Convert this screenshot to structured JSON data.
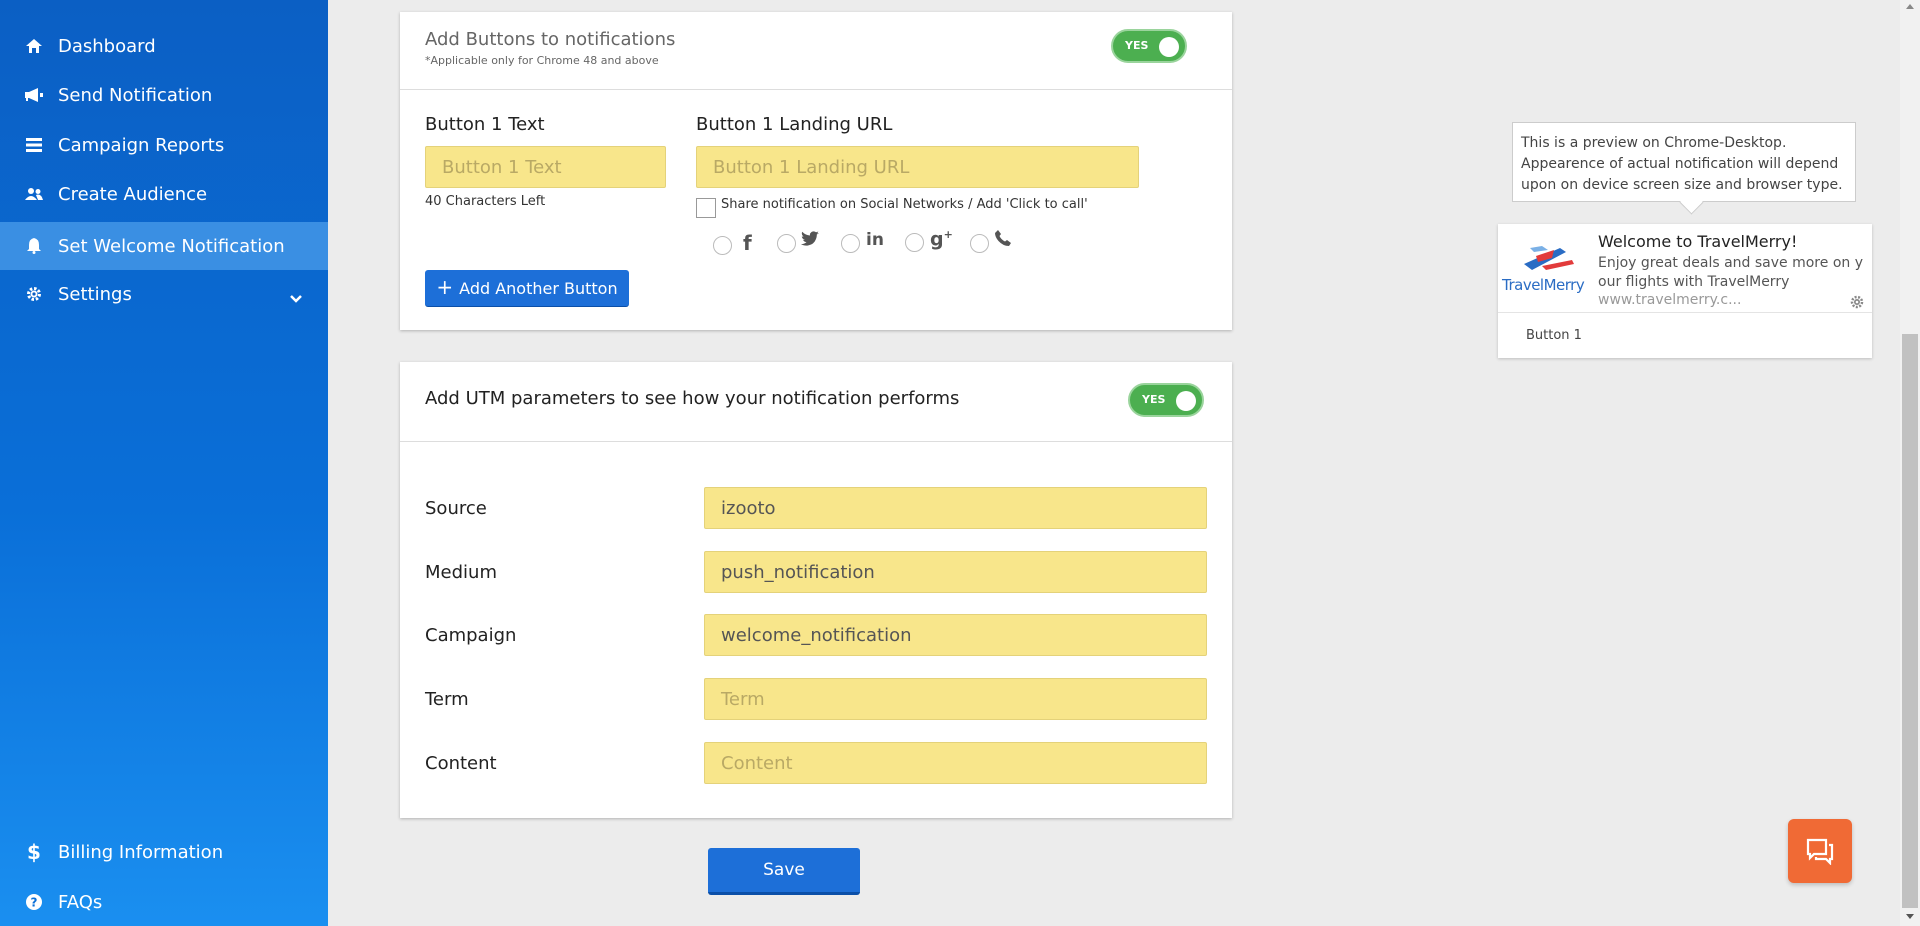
{
  "sidebar": {
    "items": [
      {
        "label": "Dashboard",
        "icon": "home-icon"
      },
      {
        "label": "Send Notification",
        "icon": "megaphone-icon"
      },
      {
        "label": "Campaign Reports",
        "icon": "list-icon"
      },
      {
        "label": "Create Audience",
        "icon": "users-icon"
      },
      {
        "label": "Set Welcome Notification",
        "icon": "bell-icon",
        "active": true
      },
      {
        "label": "Settings",
        "icon": "gear-icon"
      }
    ],
    "bottom": [
      {
        "label": "Billing Information",
        "icon": "dollar-icon"
      },
      {
        "label": "FAQs",
        "icon": "question-icon"
      }
    ]
  },
  "buttons_card": {
    "title": "Add Buttons to notifications",
    "subtitle": "*Applicable only for Chrome 48 and above",
    "toggle": "YES",
    "button1_text_label": "Button 1 Text",
    "button1_text_placeholder": "Button 1 Text",
    "chars_left": "40 Characters Left",
    "button1_url_label": "Button 1 Landing URL",
    "button1_url_placeholder": "Button 1 Landing URL",
    "share_label": "Share notification on Social Networks / Add 'Click to call'",
    "add_button_label": "Add Another Button"
  },
  "utm_card": {
    "title": "Add UTM parameters to see how your notification performs",
    "toggle": "YES",
    "fields": [
      {
        "label": "Source",
        "value": "izooto",
        "placeholder": ""
      },
      {
        "label": "Medium",
        "value": "push_notification",
        "placeholder": ""
      },
      {
        "label": "Campaign",
        "value": "welcome_notification",
        "placeholder": ""
      },
      {
        "label": "Term",
        "value": "",
        "placeholder": "Term"
      },
      {
        "label": "Content",
        "value": "",
        "placeholder": "Content"
      }
    ]
  },
  "save_label": "Save",
  "preview": {
    "tooltip": "This is a preview on Chrome-Desktop. Appearence of actual notification will depend upon on device screen size and browser type.",
    "title": "Welcome to TravelMerry!",
    "body": "Enjoy great deals and save more on y our flights with TravelMerry",
    "site": "www.travelmerry.c...",
    "logo_text": "TravelMerry",
    "button1": "Button 1"
  },
  "colors": {
    "sidebar": "#0b5fc4",
    "input_bg": "#f8e68b",
    "toggle": "#4caf50",
    "primary": "#1d6fd8",
    "chat": "#f06a35"
  }
}
